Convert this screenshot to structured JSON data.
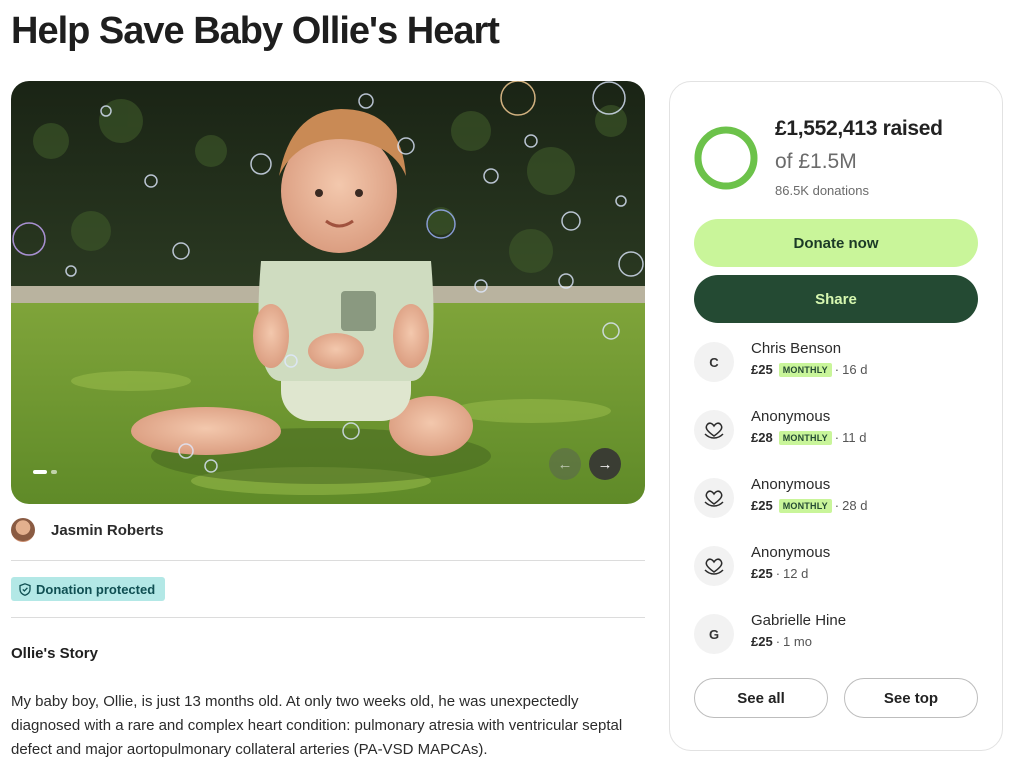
{
  "page": {
    "title": "Help Save Baby Ollie's Heart"
  },
  "hero": {
    "image_alt": "Baby sitting on grass surrounded by soap bubbles",
    "prev_icon": "arrow-left-icon",
    "next_icon": "arrow-right-icon",
    "slide_count": 2,
    "active_slide": 1
  },
  "organizer": {
    "name": "Jasmin Roberts"
  },
  "badge": {
    "label": "Donation protected",
    "icon": "shield-icon"
  },
  "story": {
    "title": "Ollie's Story",
    "text": "My baby boy, Ollie, is just 13 months old. At only two weeks old, he was unexpectedly diagnosed with a rare and complex heart condition: pulmonary atresia with ventricular septal defect and major aortopulmonary collateral arteries (PA-VSD MAPCAs)."
  },
  "fundraiser": {
    "raised": "£1,552,413 raised",
    "goal": "of £1.5M",
    "donations": "86.5K donations",
    "progress_fraction": 1.0,
    "ring_color": "#6cc24a",
    "donate_label": "Donate now",
    "share_label": "Share",
    "see_all_label": "See all",
    "see_top_label": "See top"
  },
  "donors": [
    {
      "name": "Chris Benson",
      "initial": "C",
      "amount": "£25",
      "monthly": "MONTHLY",
      "when": "16 d",
      "icon": ""
    },
    {
      "name": "Anonymous",
      "initial": "",
      "amount": "£28",
      "monthly": "MONTHLY",
      "when": "11 d",
      "icon": "heart-hand-icon"
    },
    {
      "name": "Anonymous",
      "initial": "",
      "amount": "£25",
      "monthly": "MONTHLY",
      "when": "28 d",
      "icon": "heart-hand-icon"
    },
    {
      "name": "Anonymous",
      "initial": "",
      "amount": "£25",
      "monthly": "",
      "when": "12 d",
      "icon": "heart-hand-icon"
    },
    {
      "name": "Gabrielle Hine",
      "initial": "G",
      "amount": "£25",
      "monthly": "",
      "when": "1 mo",
      "icon": ""
    }
  ],
  "colors": {
    "donate_bg": "#c9f59a",
    "share_bg": "#244a33",
    "badge_bg": "#b3e8e6"
  }
}
